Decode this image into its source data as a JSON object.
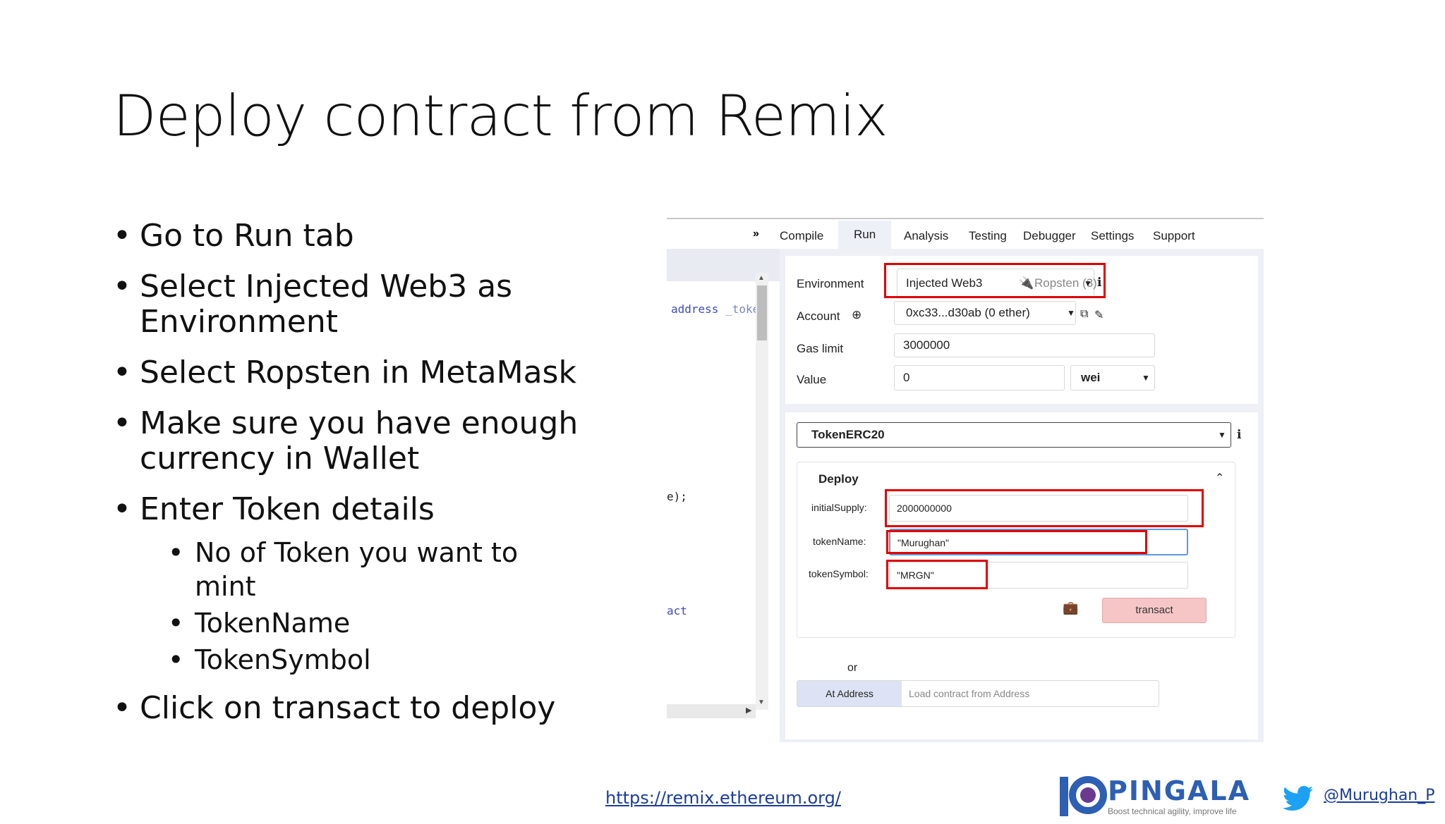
{
  "slide": {
    "title": "Deploy contract from Remix",
    "bullets": [
      "Go to Run tab",
      "Select Injected Web3 as Environment",
      "Select Ropsten in MetaMask",
      "Make sure you have enough currency in Wallet",
      "Enter Token details",
      "Click on transact to deploy"
    ],
    "sub_bullets": [
      "No of Token you want to mint",
      "TokenName",
      "TokenSymbol"
    ]
  },
  "remix": {
    "tabs": [
      "Compile",
      "Run",
      "Analysis",
      "Testing",
      "Debugger",
      "Settings",
      "Support"
    ],
    "active_tab": "Run",
    "editor_snippets": {
      "line1": "address _toke",
      "line2": "e);",
      "line3": "act"
    },
    "environment": {
      "label": "Environment",
      "value": "Injected Web3",
      "network": "Ropsten (3)"
    },
    "account": {
      "label": "Account",
      "value": "0xc33...d30ab (0 ether)"
    },
    "gas_limit": {
      "label": "Gas limit",
      "value": "3000000"
    },
    "value": {
      "label": "Value",
      "amount": "0",
      "unit": "wei"
    },
    "contract": "TokenERC20",
    "deploy": {
      "header": "Deploy",
      "fields": [
        {
          "label": "initialSupply:",
          "value": "2000000000"
        },
        {
          "label": "tokenName:",
          "value": "\"Murughan\""
        },
        {
          "label": "tokenSymbol:",
          "value": "\"MRGN\""
        }
      ],
      "button": "transact"
    },
    "or_text": "or",
    "at_address": {
      "button": "At Address",
      "placeholder": "Load contract from Address"
    }
  },
  "footer": {
    "url": "https://remix.ethereum.org/",
    "brand": "PINGALA",
    "tagline": "Boost technical agility, improve life",
    "twitter": "@Murughan_P"
  },
  "colors": {
    "highlight_red": "#e00000",
    "transact_bg": "#f6c6c6",
    "brand_blue": "#2d5fb3"
  }
}
